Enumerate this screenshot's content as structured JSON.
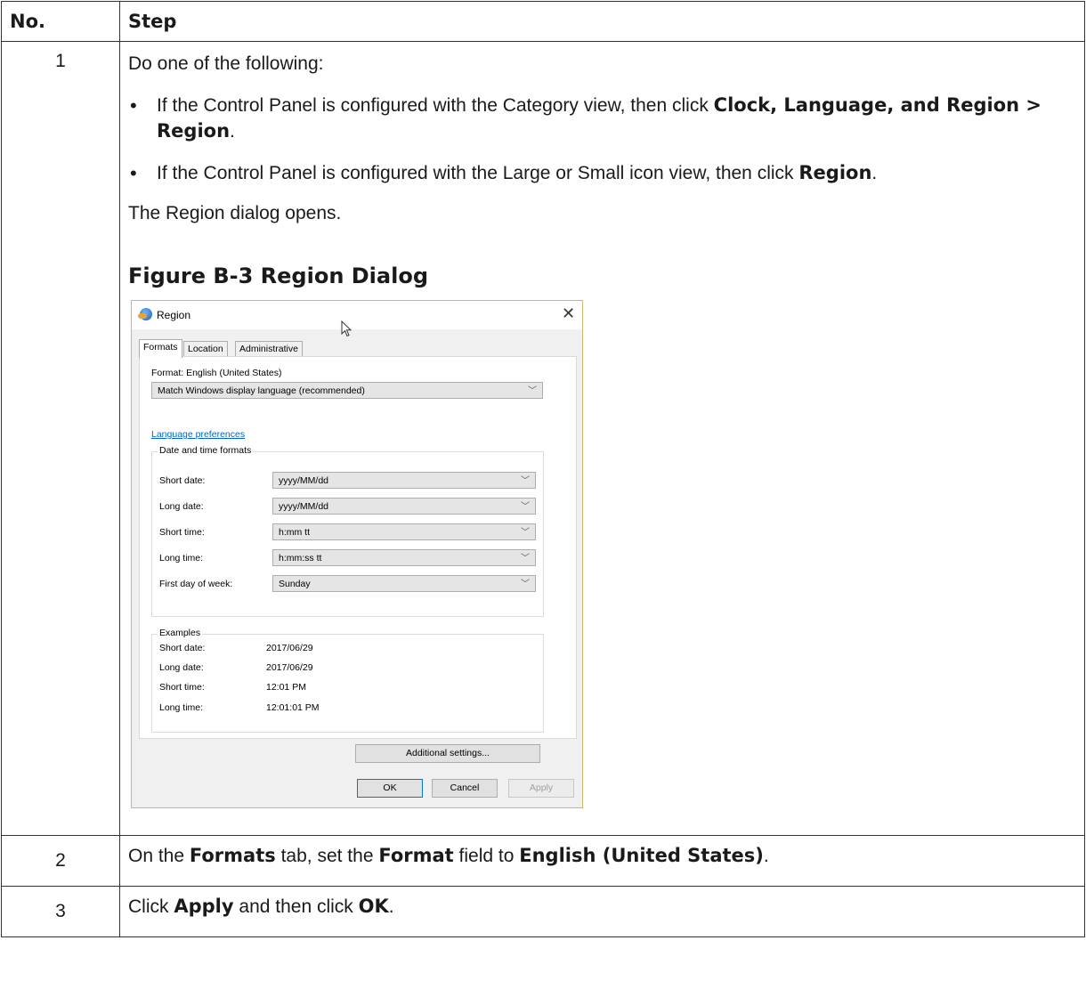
{
  "table": {
    "header_no": "No.",
    "header_step": "Step"
  },
  "row1": {
    "num": "1",
    "intro": "Do one of the following:",
    "bullet1_pre": "If the Control Panel is configured with the Category view, then click ",
    "bullet1_bold": "Clock, Language, and Region > Region",
    "bullet1_post": ".",
    "bullet2_pre": "If the Control Panel is configured with the Large or Small icon view, then click ",
    "bullet2_bold": "Region",
    "bullet2_post": ".",
    "result": "The Region dialog opens.",
    "figure_title": "Figure B-3 Region Dialog"
  },
  "dialog": {
    "title": "Region",
    "close_glyph": "✕",
    "tabs": [
      "Formats",
      "Location",
      "Administrative"
    ],
    "format_label": "Format: English (United States)",
    "format_value": "Match Windows display language (recommended)",
    "language_link": "Language preferences",
    "dt_group_title": "Date and time formats",
    "dt_rows": [
      {
        "label": "Short date:",
        "value": "yyyy/MM/dd"
      },
      {
        "label": "Long date:",
        "value": "yyyy/MM/dd"
      },
      {
        "label": "Short time:",
        "value": "h:mm tt"
      },
      {
        "label": "Long time:",
        "value": "h:mm:ss tt"
      },
      {
        "label": "First day of week:",
        "value": "Sunday"
      }
    ],
    "examples_title": "Examples",
    "examples": [
      {
        "label": "Short date:",
        "value": "2017/06/29"
      },
      {
        "label": "Long date:",
        "value": "2017/06/29"
      },
      {
        "label": "Short time:",
        "value": "12:01 PM"
      },
      {
        "label": "Long time:",
        "value": "12:01:01 PM"
      }
    ],
    "additional_settings": "Additional settings...",
    "ok": "OK",
    "cancel": "Cancel",
    "apply": "Apply"
  },
  "row2": {
    "num": "2",
    "t1": "On the ",
    "b1": "Formats",
    "t2": " tab, set the ",
    "b2": "Format",
    "t3": " field to ",
    "b3": "English (United States)",
    "t4": "."
  },
  "row3": {
    "num": "3",
    "t1": "Click ",
    "b1": "Apply",
    "t2": " and then click ",
    "b2": "OK",
    "t3": "."
  }
}
